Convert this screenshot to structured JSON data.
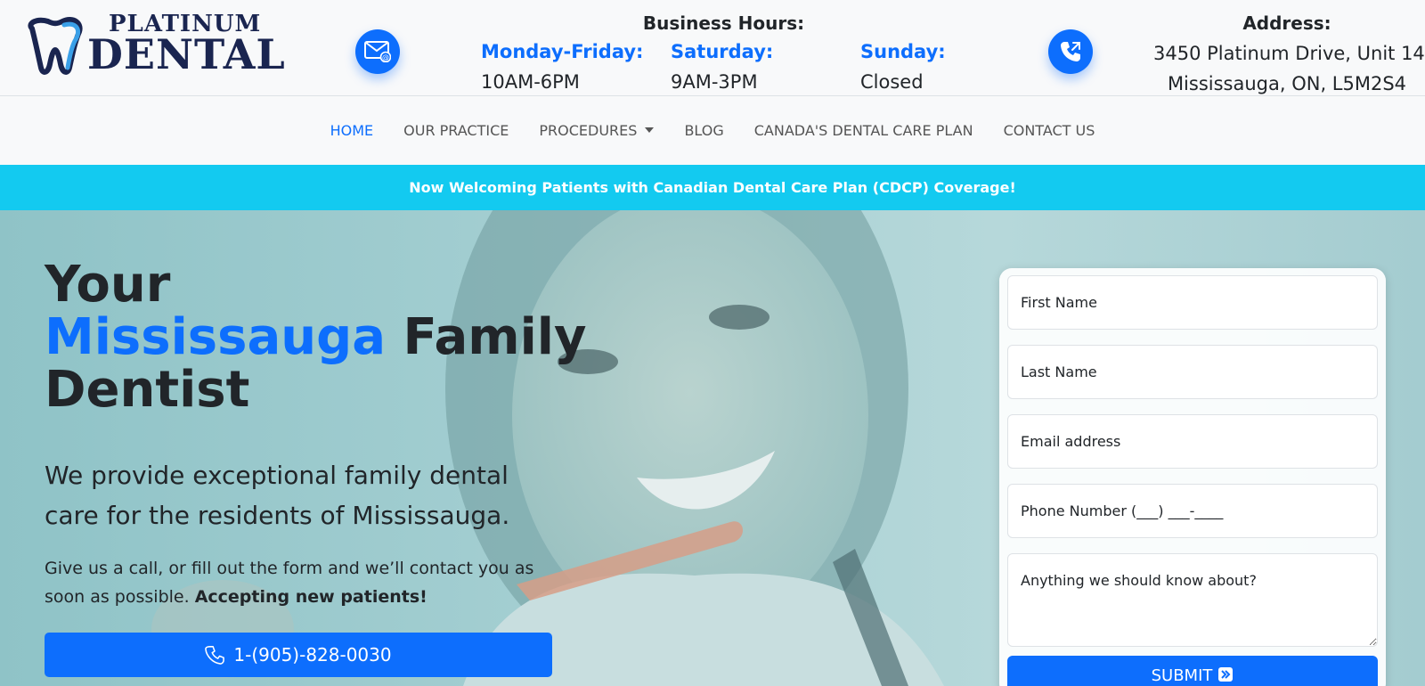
{
  "brand": {
    "name_top": "PLATINUM",
    "name_bottom": "DENTAL",
    "color": "#1a2550",
    "accent": "#0d6efd"
  },
  "header": {
    "mail_icon": "mail-at-icon",
    "phone_icon": "phone-outgoing-icon",
    "hours_title": "Business Hours:",
    "hours": [
      {
        "day": "Monday-Friday:",
        "time": "10AM-6PM"
      },
      {
        "day": "Saturday:",
        "time": "9AM-3PM"
      },
      {
        "day": "Sunday:",
        "time": "Closed"
      }
    ],
    "address_title": "Address:",
    "address_line1": "3450 Platinum Drive, Unit 14",
    "address_line2": "Mississauga, ON, L5M2S4"
  },
  "nav": {
    "items": [
      "HOME",
      "OUR PRACTICE",
      "PROCEDURES",
      "BLOG",
      "CANADA'S DENTAL CARE PLAN",
      "CONTACT US"
    ],
    "active": "HOME"
  },
  "banner": {
    "text": "Now Welcoming Patients with Canadian Dental Care Plan (CDCP) Coverage!",
    "color": "#13caf0"
  },
  "hero": {
    "title_line1": "Your",
    "title_highlight": "Mississauga",
    "title_rest": " Family",
    "title_line3": "Dentist",
    "lead": "We provide exceptional family dental care for the residents of Mississauga.",
    "text": "Give us a call, or fill out the form and we’ll contact you as soon as possible. ",
    "text_bold": "Accepting new patients!",
    "call_label": "1-(905)-828-0030"
  },
  "form": {
    "first_name_placeholder": "First Name",
    "last_name_placeholder": "Last Name",
    "email_placeholder": "Email address",
    "phone_placeholder": "Phone Number (___) ___-____",
    "message_placeholder": "Anything we should know about?",
    "submit_label": "SUBMIT"
  }
}
